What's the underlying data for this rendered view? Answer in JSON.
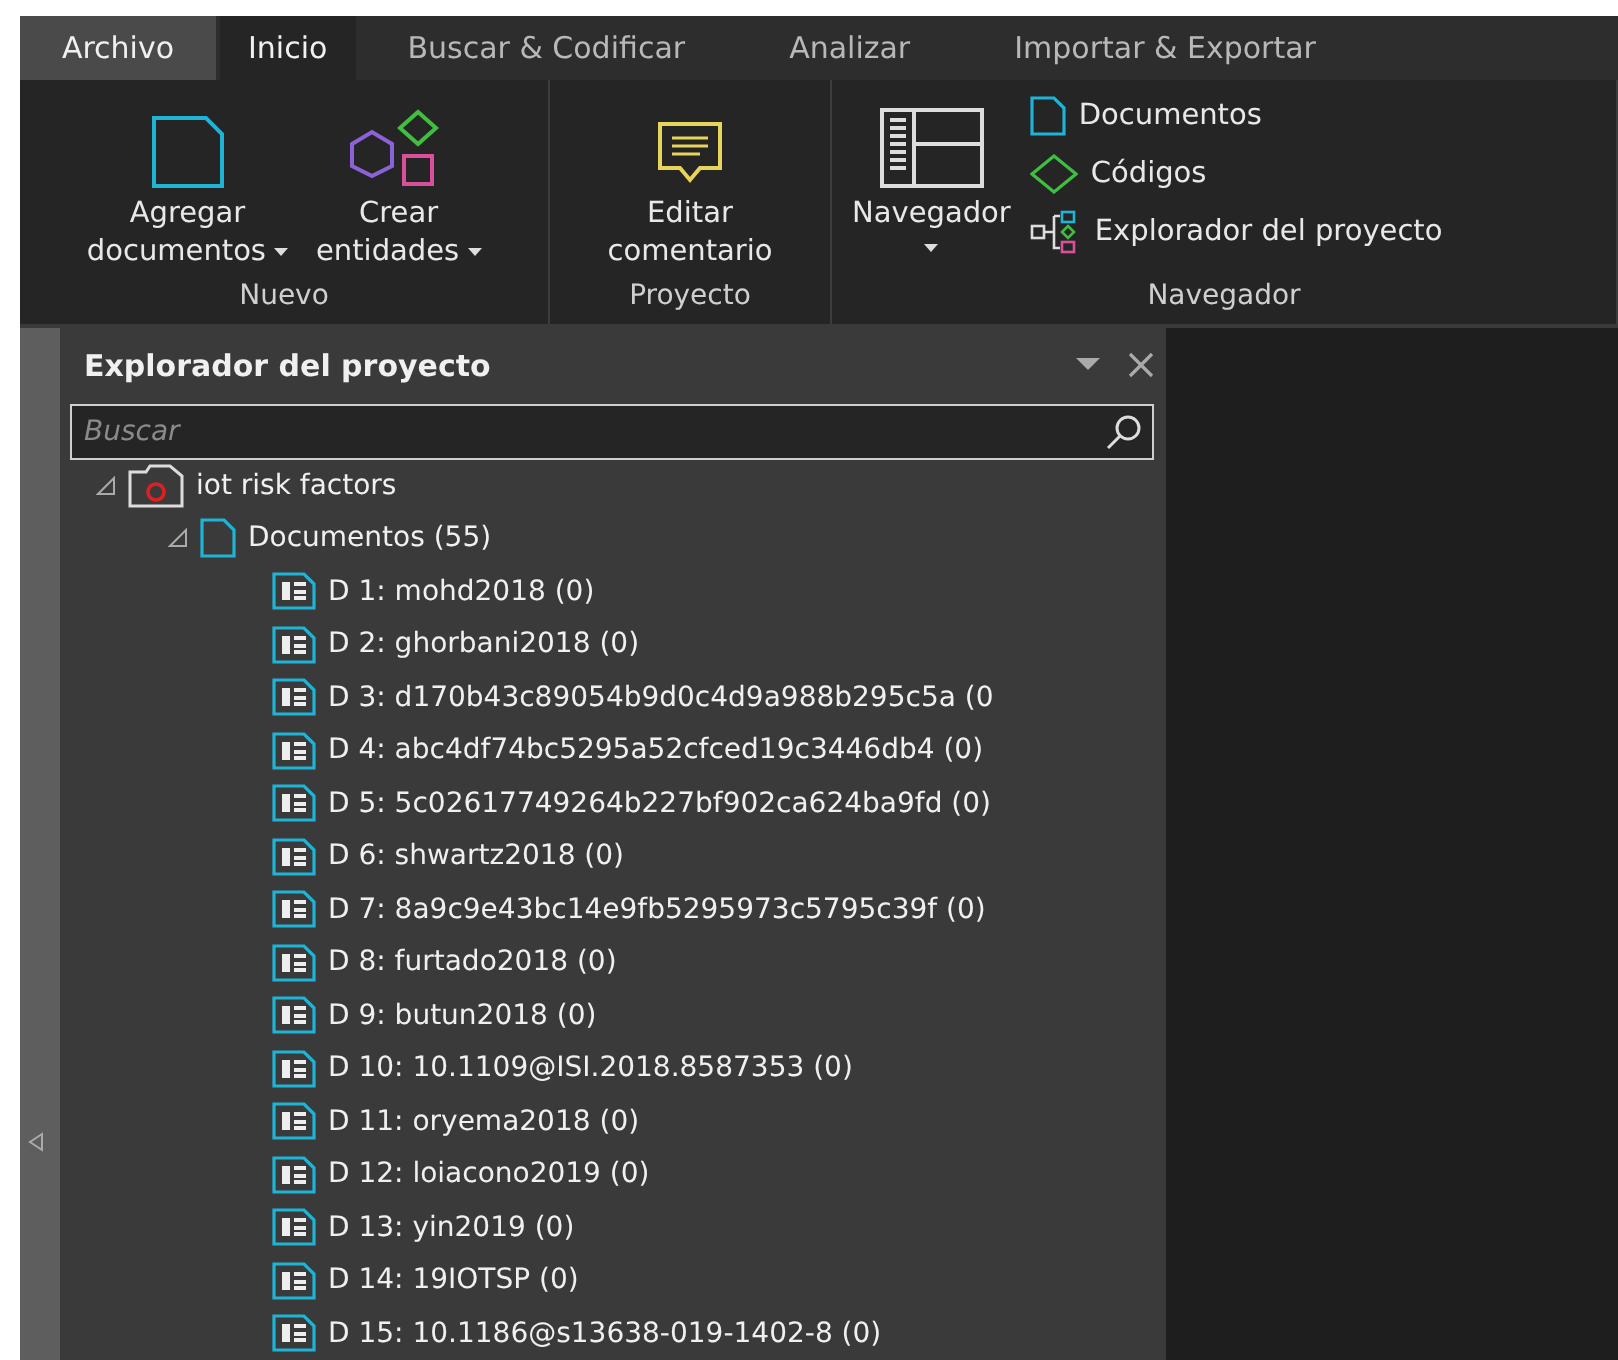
{
  "ribbon_tabs": [
    {
      "label": "Archivo",
      "kind": "file",
      "selected": false
    },
    {
      "label": "Inicio",
      "kind": "tab",
      "selected": true
    },
    {
      "label": "Buscar & Codificar",
      "kind": "tab",
      "selected": false
    },
    {
      "label": "Analizar",
      "kind": "tab",
      "selected": false
    },
    {
      "label": "Importar & Exportar",
      "kind": "tab",
      "selected": false
    }
  ],
  "ribbon_groups": [
    {
      "label": "Nuevo",
      "large_buttons": [
        {
          "kind": "document",
          "label": "Agregar",
          "label2": "documentos",
          "dropdown": true
        },
        {
          "kind": "entities",
          "label": "Crear",
          "label2": "entidades",
          "dropdown": true
        }
      ]
    },
    {
      "label": "Proyecto",
      "large_buttons": [
        {
          "kind": "comment",
          "label": "Editar",
          "label2": "comentario",
          "dropdown": false
        }
      ]
    },
    {
      "label": "Navegador",
      "large_buttons": [
        {
          "kind": "navigator",
          "label": "Navegador",
          "dropdown": true
        }
      ],
      "small_buttons": [
        {
          "kind": "document",
          "label": "Documentos"
        },
        {
          "kind": "diamond",
          "label": "Códigos"
        },
        {
          "kind": "explorer",
          "label": "Explorador del proyecto"
        }
      ]
    }
  ],
  "panel": {
    "title": "Explorador del proyecto",
    "search": {
      "placeholder": "Buscar"
    },
    "tree": [
      {
        "label": "iot risk factors",
        "kind": "project",
        "expanded": true,
        "children": [
          {
            "label": "Documentos (55)",
            "kind": "folder",
            "expanded": true,
            "children": [
              {
                "label": "D 1: mohd2018 (0)",
                "kind": "doc"
              },
              {
                "label": "D 2: ghorbani2018 (0)",
                "kind": "doc"
              },
              {
                "label": "D 3: d170b43c89054b9d0c4d9a988b295c5a (0",
                "kind": "doc"
              },
              {
                "label": "D 4: abc4df74bc5295a52cfced19c3446db4 (0)",
                "kind": "doc"
              },
              {
                "label": "D 5: 5c02617749264b227bf902ca624ba9fd (0)",
                "kind": "doc"
              },
              {
                "label": "D 6: shwartz2018 (0)",
                "kind": "doc"
              },
              {
                "label": "D 7: 8a9c9e43bc14e9fb5295973c5795c39f (0)",
                "kind": "doc"
              },
              {
                "label": "D 8: furtado2018 (0)",
                "kind": "doc"
              },
              {
                "label": "D 9: butun2018 (0)",
                "kind": "doc"
              },
              {
                "label": "D 10: 10.1109@ISI.2018.8587353 (0)",
                "kind": "doc"
              },
              {
                "label": "D 11: oryema2018 (0)",
                "kind": "doc"
              },
              {
                "label": "D 12: loiacono2019 (0)",
                "kind": "doc"
              },
              {
                "label": "D 13: yin2019 (0)",
                "kind": "doc"
              },
              {
                "label": "D 14: 19IOTSP (0)",
                "kind": "doc"
              },
              {
                "label": "D 15: 10.1186@s13638-019-1402-8 (0)",
                "kind": "doc"
              }
            ]
          }
        ]
      }
    ]
  }
}
